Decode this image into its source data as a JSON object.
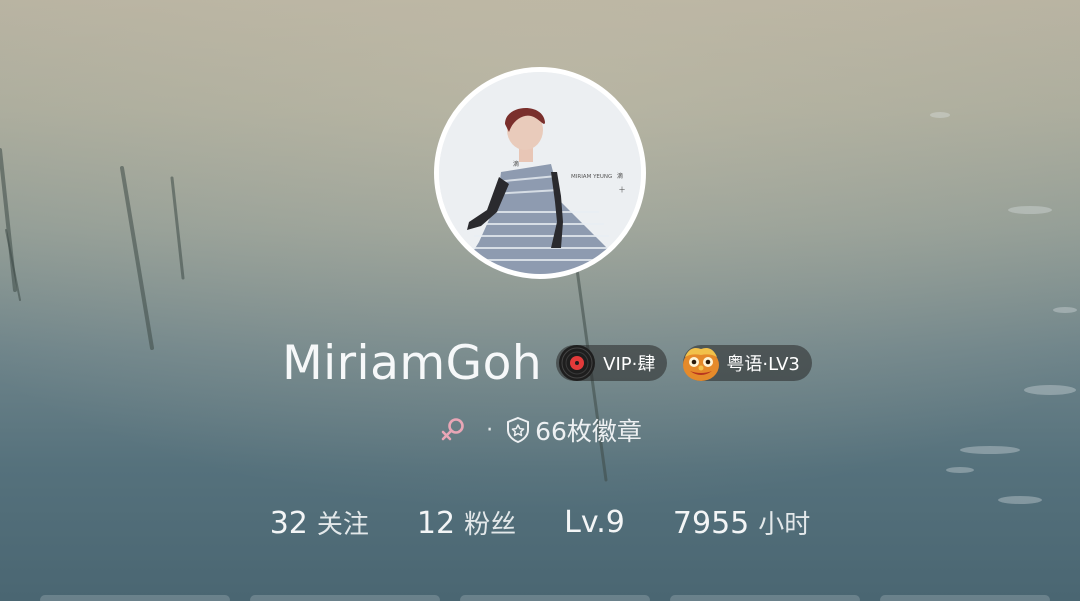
{
  "profile": {
    "username": "MiriamGoh",
    "avatar_caption": "MIRIAM YEUNG",
    "vip_badge": {
      "icon": "vinyl-disc-icon",
      "label": "VIP·肆"
    },
    "language_badge": {
      "icon": "lion-dance-icon",
      "label": "粤语·LV3"
    },
    "gender_icon": "female-icon",
    "separator": "·",
    "badges_count_icon": "badge-shield-icon",
    "badges_count_text": "66枚徽章"
  },
  "stats": {
    "following": {
      "value": "32",
      "label": "关注"
    },
    "followers": {
      "value": "12",
      "label": "粉丝"
    },
    "level": {
      "value": "Lv.9"
    },
    "listening": {
      "value": "7955",
      "label": "小时"
    }
  },
  "colors": {
    "badge_bg": "#2828288c",
    "female_icon": "#e9a6b6",
    "text": "#f6f8f9"
  }
}
